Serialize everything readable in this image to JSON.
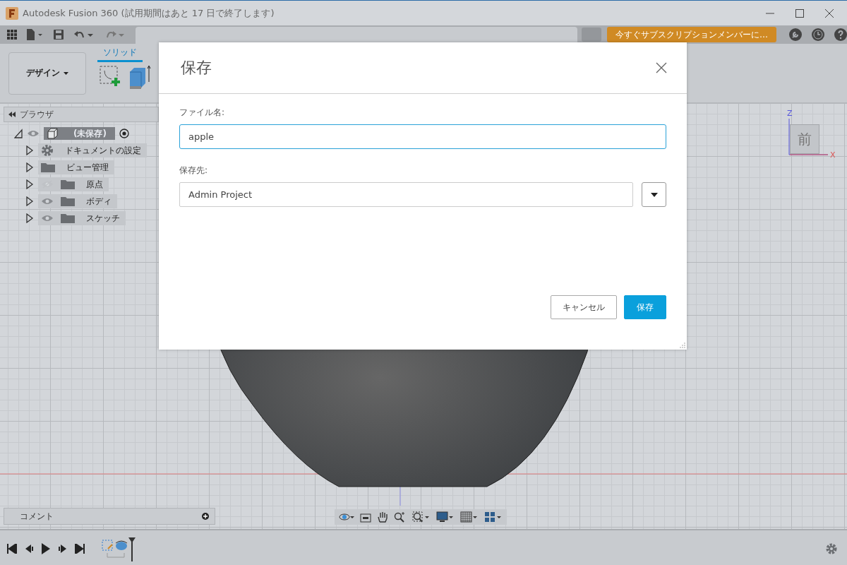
{
  "window": {
    "title": "Autodesk Fusion 360 (試用期間はあと 17 日で終了します)"
  },
  "toolbar": {
    "subscribe_button": "今すぐサブスクリプションメンバーに…"
  },
  "ribbon": {
    "workspace": "デザイン",
    "tabs": [
      {
        "label": "ソリッド",
        "selected": true
      }
    ]
  },
  "browser": {
    "title": "ブラウザ",
    "root": {
      "label": "(未保存)",
      "expanded": true,
      "active": true,
      "visible": true,
      "children": [
        {
          "label": "ドキュメントの設定",
          "kind": "settings",
          "expanded": false
        },
        {
          "label": "ビュー管理",
          "kind": "folder",
          "expanded": false
        },
        {
          "label": "原点",
          "kind": "folder",
          "expanded": false,
          "visible": false
        },
        {
          "label": "ボディ",
          "kind": "folder",
          "expanded": false,
          "visible": true
        },
        {
          "label": "スケッチ",
          "kind": "folder",
          "expanded": false,
          "visible": true
        }
      ]
    }
  },
  "viewcube": {
    "face": "前",
    "axes": [
      "Z",
      "X"
    ]
  },
  "comments": {
    "label": "コメント"
  },
  "dialog": {
    "title": "保存",
    "fields": [
      {
        "label": "ファイル名:",
        "kind": "text",
        "value": "apple",
        "focused": true
      },
      {
        "label": "保存先:",
        "kind": "select",
        "value": "Admin Project",
        "focused": false
      }
    ],
    "buttons": [
      {
        "label": "キャンセル",
        "primary": false
      },
      {
        "label": "保存",
        "primary": true
      }
    ]
  }
}
